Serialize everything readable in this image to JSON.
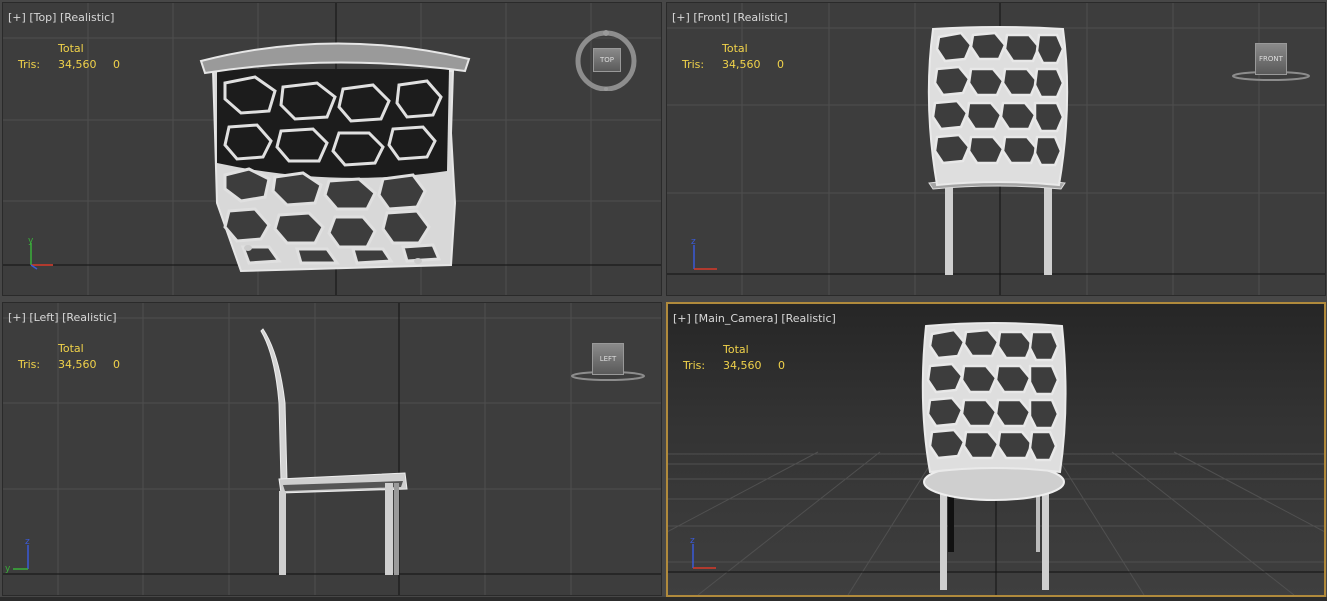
{
  "viewports": {
    "top": {
      "plus": "[+]",
      "view": "[Top]",
      "mode": "[Realistic]",
      "cube_label": "TOP"
    },
    "front": {
      "plus": "[+]",
      "view": "[Front]",
      "mode": "[Realistic]",
      "cube_label": "FRONT"
    },
    "left": {
      "plus": "[+]",
      "view": "[Left]",
      "mode": "[Realistic]",
      "cube_label": "LEFT"
    },
    "camera": {
      "plus": "[+]",
      "view": "[Main_Camera]",
      "mode": "[Realistic]"
    }
  },
  "stats": {
    "total_label": "Total",
    "tris_label": "Tris:",
    "tris_value": "34,560",
    "tris_selected": "0"
  },
  "axis": {
    "x": "x",
    "y": "y",
    "z": "z"
  },
  "colors": {
    "stats_text": "#f0d24a",
    "active_border": "#b08a3c",
    "viewport_bg": "#3d3d3d",
    "x_axis": "#d83a2a",
    "y_axis": "#3ab03a",
    "z_axis": "#3a5ad8"
  }
}
